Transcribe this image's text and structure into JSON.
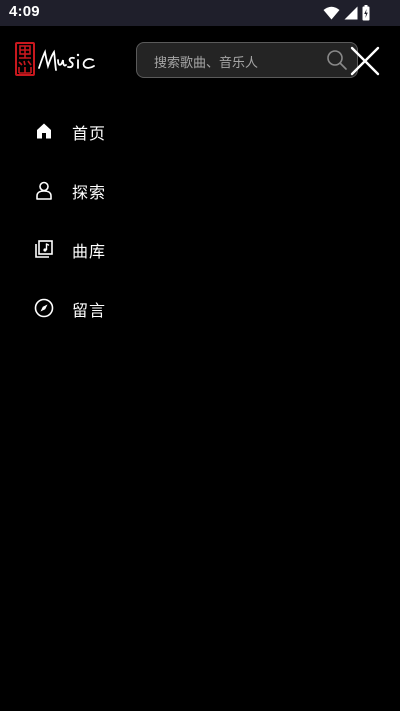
{
  "status_bar": {
    "time": "4:09",
    "icons": [
      "wifi-icon",
      "cellular-signal-icon",
      "battery-icon"
    ]
  },
  "header": {
    "logo_alt": "Music",
    "search": {
      "placeholder": "搜索歌曲、音乐人"
    },
    "icons": [
      "search-icon",
      "close-icon"
    ]
  },
  "menu": {
    "items": [
      {
        "label": "首页",
        "icon": "home-icon"
      },
      {
        "label": "探索",
        "icon": "person-icon"
      },
      {
        "label": "曲库",
        "icon": "music-library-icon"
      },
      {
        "label": "留言",
        "icon": "compass-icon"
      }
    ]
  },
  "colors": {
    "background": "#000000",
    "status_bar": "#1f1f2b",
    "search_bg": "#242424",
    "search_border": "#5a5a5a",
    "placeholder": "#a5a5a5",
    "logo_red": "#c8181e"
  }
}
